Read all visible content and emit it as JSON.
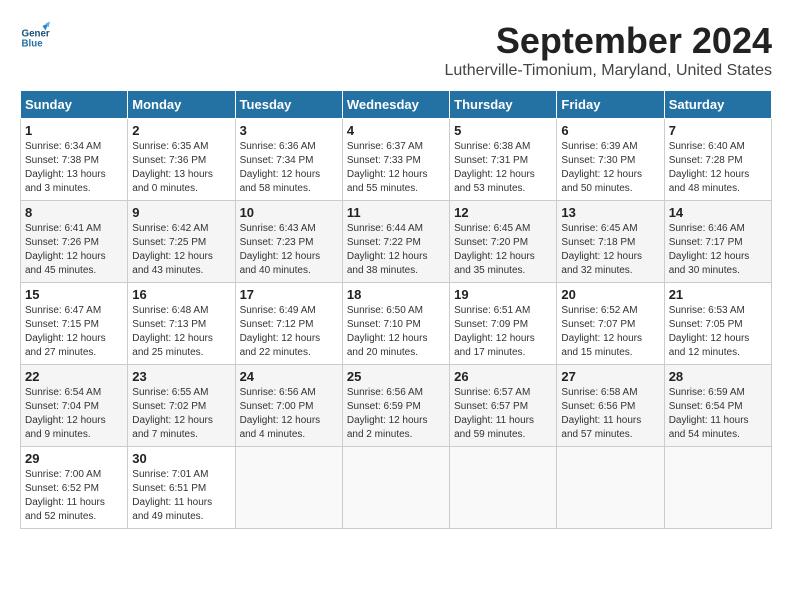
{
  "header": {
    "logo_line1": "General",
    "logo_line2": "Blue",
    "month_title": "September 2024",
    "location": "Lutherville-Timonium, Maryland, United States"
  },
  "weekdays": [
    "Sunday",
    "Monday",
    "Tuesday",
    "Wednesday",
    "Thursday",
    "Friday",
    "Saturday"
  ],
  "weeks": [
    [
      {
        "day": "1",
        "info": "Sunrise: 6:34 AM\nSunset: 7:38 PM\nDaylight: 13 hours\nand 3 minutes."
      },
      {
        "day": "2",
        "info": "Sunrise: 6:35 AM\nSunset: 7:36 PM\nDaylight: 13 hours\nand 0 minutes."
      },
      {
        "day": "3",
        "info": "Sunrise: 6:36 AM\nSunset: 7:34 PM\nDaylight: 12 hours\nand 58 minutes."
      },
      {
        "day": "4",
        "info": "Sunrise: 6:37 AM\nSunset: 7:33 PM\nDaylight: 12 hours\nand 55 minutes."
      },
      {
        "day": "5",
        "info": "Sunrise: 6:38 AM\nSunset: 7:31 PM\nDaylight: 12 hours\nand 53 minutes."
      },
      {
        "day": "6",
        "info": "Sunrise: 6:39 AM\nSunset: 7:30 PM\nDaylight: 12 hours\nand 50 minutes."
      },
      {
        "day": "7",
        "info": "Sunrise: 6:40 AM\nSunset: 7:28 PM\nDaylight: 12 hours\nand 48 minutes."
      }
    ],
    [
      {
        "day": "8",
        "info": "Sunrise: 6:41 AM\nSunset: 7:26 PM\nDaylight: 12 hours\nand 45 minutes."
      },
      {
        "day": "9",
        "info": "Sunrise: 6:42 AM\nSunset: 7:25 PM\nDaylight: 12 hours\nand 43 minutes."
      },
      {
        "day": "10",
        "info": "Sunrise: 6:43 AM\nSunset: 7:23 PM\nDaylight: 12 hours\nand 40 minutes."
      },
      {
        "day": "11",
        "info": "Sunrise: 6:44 AM\nSunset: 7:22 PM\nDaylight: 12 hours\nand 38 minutes."
      },
      {
        "day": "12",
        "info": "Sunrise: 6:45 AM\nSunset: 7:20 PM\nDaylight: 12 hours\nand 35 minutes."
      },
      {
        "day": "13",
        "info": "Sunrise: 6:45 AM\nSunset: 7:18 PM\nDaylight: 12 hours\nand 32 minutes."
      },
      {
        "day": "14",
        "info": "Sunrise: 6:46 AM\nSunset: 7:17 PM\nDaylight: 12 hours\nand 30 minutes."
      }
    ],
    [
      {
        "day": "15",
        "info": "Sunrise: 6:47 AM\nSunset: 7:15 PM\nDaylight: 12 hours\nand 27 minutes."
      },
      {
        "day": "16",
        "info": "Sunrise: 6:48 AM\nSunset: 7:13 PM\nDaylight: 12 hours\nand 25 minutes."
      },
      {
        "day": "17",
        "info": "Sunrise: 6:49 AM\nSunset: 7:12 PM\nDaylight: 12 hours\nand 22 minutes."
      },
      {
        "day": "18",
        "info": "Sunrise: 6:50 AM\nSunset: 7:10 PM\nDaylight: 12 hours\nand 20 minutes."
      },
      {
        "day": "19",
        "info": "Sunrise: 6:51 AM\nSunset: 7:09 PM\nDaylight: 12 hours\nand 17 minutes."
      },
      {
        "day": "20",
        "info": "Sunrise: 6:52 AM\nSunset: 7:07 PM\nDaylight: 12 hours\nand 15 minutes."
      },
      {
        "day": "21",
        "info": "Sunrise: 6:53 AM\nSunset: 7:05 PM\nDaylight: 12 hours\nand 12 minutes."
      }
    ],
    [
      {
        "day": "22",
        "info": "Sunrise: 6:54 AM\nSunset: 7:04 PM\nDaylight: 12 hours\nand 9 minutes."
      },
      {
        "day": "23",
        "info": "Sunrise: 6:55 AM\nSunset: 7:02 PM\nDaylight: 12 hours\nand 7 minutes."
      },
      {
        "day": "24",
        "info": "Sunrise: 6:56 AM\nSunset: 7:00 PM\nDaylight: 12 hours\nand 4 minutes."
      },
      {
        "day": "25",
        "info": "Sunrise: 6:56 AM\nSunset: 6:59 PM\nDaylight: 12 hours\nand 2 minutes."
      },
      {
        "day": "26",
        "info": "Sunrise: 6:57 AM\nSunset: 6:57 PM\nDaylight: 11 hours\nand 59 minutes."
      },
      {
        "day": "27",
        "info": "Sunrise: 6:58 AM\nSunset: 6:56 PM\nDaylight: 11 hours\nand 57 minutes."
      },
      {
        "day": "28",
        "info": "Sunrise: 6:59 AM\nSunset: 6:54 PM\nDaylight: 11 hours\nand 54 minutes."
      }
    ],
    [
      {
        "day": "29",
        "info": "Sunrise: 7:00 AM\nSunset: 6:52 PM\nDaylight: 11 hours\nand 52 minutes."
      },
      {
        "day": "30",
        "info": "Sunrise: 7:01 AM\nSunset: 6:51 PM\nDaylight: 11 hours\nand 49 minutes."
      },
      null,
      null,
      null,
      null,
      null
    ]
  ]
}
